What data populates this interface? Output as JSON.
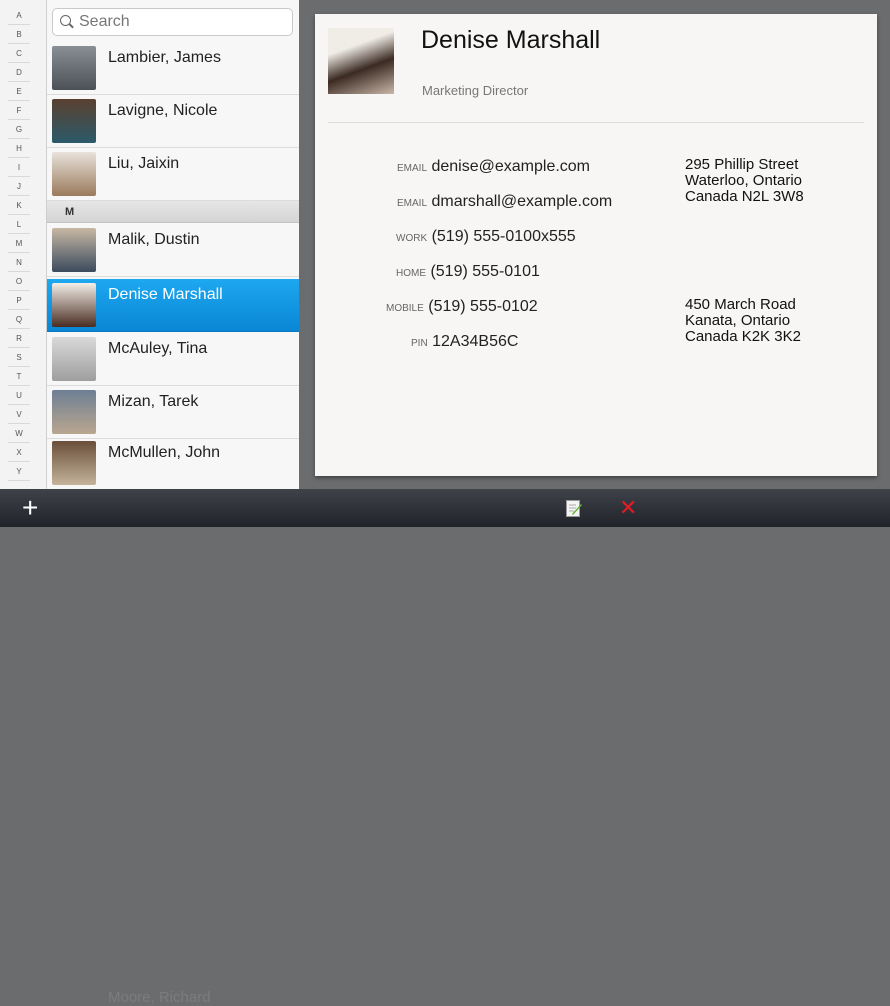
{
  "alphabet": [
    "A",
    "B",
    "C",
    "D",
    "E",
    "F",
    "G",
    "H",
    "I",
    "J",
    "K",
    "L",
    "M",
    "N",
    "O",
    "P",
    "Q",
    "R",
    "S",
    "T",
    "U",
    "V",
    "W",
    "X",
    "Y"
  ],
  "search": {
    "placeholder": "Search"
  },
  "contacts_above": [
    {
      "name": "Lambier, James"
    },
    {
      "name": "Lavigne, Nicole"
    },
    {
      "name": "Liu, Jaixin"
    }
  ],
  "section_letter": "M",
  "contacts_m": [
    {
      "name": "Malik, Dustin",
      "selected": false
    },
    {
      "name": "Denise Marshall",
      "selected": true
    },
    {
      "name": "McAuley, Tina",
      "selected": false
    },
    {
      "name": "Mizan, Tarek",
      "selected": false
    },
    {
      "name": "McMullen, John",
      "selected": false
    }
  ],
  "ghost_contact": "Moore, Richard",
  "detail": {
    "name": "Denise Marshall",
    "role": "Marketing Director",
    "fields": [
      {
        "label": "EMAIL",
        "value": "denise@example.com"
      },
      {
        "label": "EMAIL",
        "value": "dmarshall@example.com"
      },
      {
        "label": "WORK",
        "value": "(519) 555-0100x555"
      },
      {
        "label": "HOME",
        "value": "(519) 555-0101"
      },
      {
        "label": "MOBILE",
        "value": "(519) 555-0102"
      },
      {
        "label": "PIN",
        "value": "12A34B56C"
      }
    ],
    "addresses": [
      "295 Phillip Street\nWaterloo, Ontario\nCanada N2L 3W8",
      "450 March Road\nKanata, Ontario\nCanada K2K 3K2"
    ]
  },
  "bottom_bar": {
    "add_label": "+"
  },
  "colors": {
    "selected": "#0a86d4",
    "delete": "#e31b23",
    "edit": "#5fb52a"
  }
}
